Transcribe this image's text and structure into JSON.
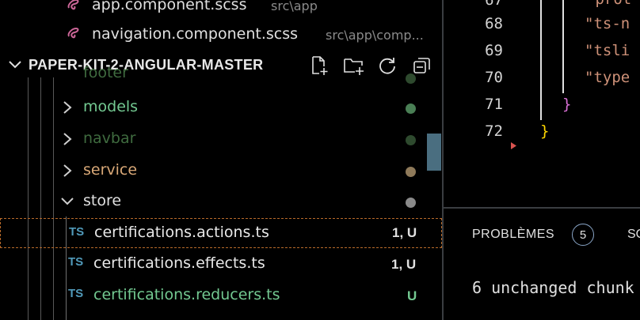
{
  "open_editors": [
    {
      "name": "app.component.scss",
      "path": "src\\app"
    },
    {
      "name": "navigation.component.scss",
      "path": "src\\app\\comp..."
    }
  ],
  "explorer": {
    "section_title": "PAPER-KIT-2-ANGULAR-MASTER",
    "header_icons": [
      "new-file-icon",
      "new-folder-icon",
      "refresh-icon",
      "collapse-all-icon"
    ],
    "folders": [
      {
        "label": "footer",
        "color": "#3f6b3f",
        "dot_color": "#2e4a2e"
      },
      {
        "label": "models",
        "color": "#73c991",
        "dot_color": "#4a7f55"
      },
      {
        "label": "navbar",
        "color": "#3f6b3f",
        "dot_color": "#2e4a2e"
      },
      {
        "label": "service",
        "color": "#d9a877",
        "dot_color": "#8f7a5a"
      },
      {
        "label": "store",
        "color": "#e0e0e0",
        "dot_color": "#8a8a8a"
      }
    ],
    "files": [
      {
        "icon": "TS",
        "label": "certifications.actions.ts",
        "status": "1, U",
        "color": "#e8e8e8",
        "status_color": "#e0e0e0"
      },
      {
        "icon": "TS",
        "label": "certifications.effects.ts",
        "status": "1, U",
        "color": "#e8e8e8",
        "status_color": "#e0e0e0"
      },
      {
        "icon": "TS",
        "label": "certifications.reducers.ts",
        "status": "U",
        "color": "#73c991",
        "status_color": "#73c991"
      }
    ]
  },
  "editor": {
    "line_numbers": [
      "67",
      "68",
      "69",
      "70",
      "71",
      "72"
    ],
    "lines": [
      {
        "text": "\"prot"
      },
      {
        "text": "\"ts-n"
      },
      {
        "text": "\"tsli"
      },
      {
        "text": "\"type"
      },
      {
        "text": "}"
      },
      {
        "text": "}"
      }
    ],
    "bracket_colors": {
      "inner": "#da70d6",
      "outer": "#ffd700"
    }
  },
  "panel": {
    "tab_problems": "PROBLÈMES",
    "problems_count": "5",
    "tab_second": "SO",
    "terminal_text": "6 unchanged chunk"
  },
  "colors": {
    "accent_ts": "#519aba",
    "sass_pink": "#cd6799",
    "modified_dashed": "#b86a2a"
  }
}
